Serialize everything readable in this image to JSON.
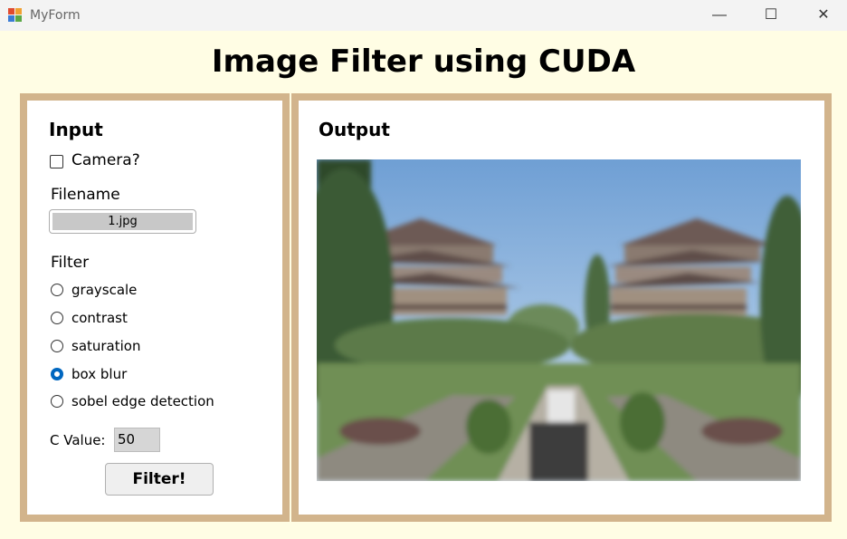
{
  "window": {
    "title": "MyForm",
    "icon": "winforms-app-icon",
    "minimize_glyph": "—",
    "maximize_glyph": "☐",
    "close_glyph": "✕"
  },
  "heading": "Image Filter using CUDA",
  "input_panel": {
    "title": "Input",
    "camera_label": "Camera?",
    "camera_checked": false,
    "filename_label": "Filename",
    "filename_value": "1.jpg",
    "filter_label": "Filter",
    "filters": [
      {
        "label": "grayscale",
        "selected": false
      },
      {
        "label": "contrast",
        "selected": false
      },
      {
        "label": "saturation",
        "selected": false
      },
      {
        "label": "box blur",
        "selected": true
      },
      {
        "label": "sobel edge detection",
        "selected": false
      }
    ],
    "c_value_label": "C Value:",
    "c_value": "50",
    "filter_button": "Filter!"
  },
  "output_panel": {
    "title": "Output",
    "image": "blurred-campus-photo"
  },
  "colors": {
    "background": "#fffde4",
    "panel_border": "#d2b48c",
    "radio_accent": "#0067c0"
  }
}
